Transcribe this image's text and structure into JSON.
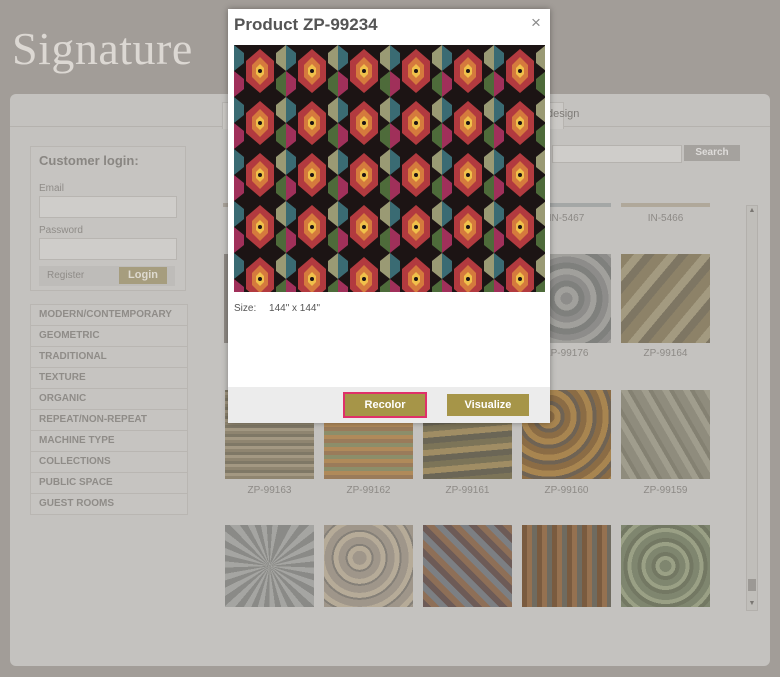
{
  "site": {
    "logo": "Signature"
  },
  "nav": {
    "tab_partial": "design"
  },
  "login": {
    "title": "Customer login:",
    "email_label": "Email",
    "password_label": "Password",
    "register_label": "Register",
    "login_label": "Login"
  },
  "categories": [
    "MODERN/CONTEMPORARY",
    "GEOMETRIC",
    "TRADITIONAL",
    "TEXTURE",
    "ORGANIC",
    "REPEAT/NON-REPEAT",
    "MACHINE TYPE",
    "COLLECTIONS",
    "PUBLIC SPACE",
    "GUEST ROOMS"
  ],
  "search": {
    "button_label": "Search"
  },
  "grid": {
    "row1_labels": [
      "IN-5467",
      "IN-5466"
    ],
    "row2_labels": [
      "ZP-99176",
      "ZP-99164"
    ],
    "row3_labels": [
      "ZP-99163",
      "ZP-99162",
      "ZP-99161",
      "ZP-99160",
      "ZP-99159"
    ]
  },
  "modal": {
    "title": "Product ZP-99234",
    "close_glyph": "×",
    "size_label": "Size:",
    "size_value": "144\" x 144\"",
    "recolor_label": "Recolor",
    "visualize_label": "Visualize"
  },
  "colors": {
    "accent_button": "#a69548",
    "highlight_outline": "#e0306a",
    "overlay_bg": "#a29d98"
  }
}
